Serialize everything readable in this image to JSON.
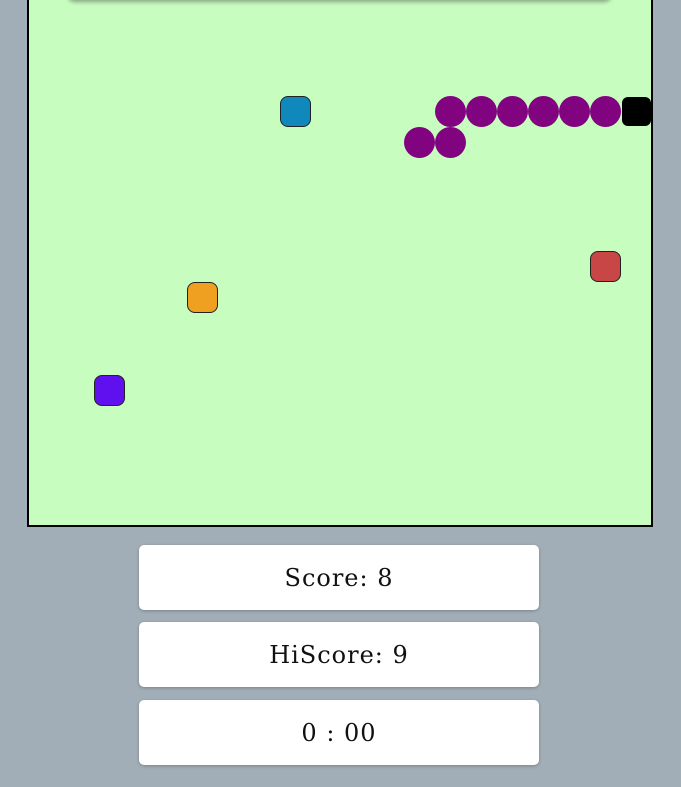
{
  "colors": {
    "page_background": "#a2aeb7",
    "board_background": "#c8fdc0",
    "snake_body": "#820380",
    "snake_head": "#000000"
  },
  "snake": {
    "head_cell": [
      19,
      3
    ],
    "body_cells": [
      [
        18,
        3
      ],
      [
        17,
        3
      ],
      [
        16,
        3
      ],
      [
        15,
        3
      ],
      [
        14,
        3
      ],
      [
        13,
        3
      ],
      [
        13,
        4
      ],
      [
        12,
        4
      ]
    ]
  },
  "items": [
    {
      "name": "blue-block",
      "color": "#1188bb",
      "cell": [
        8,
        3
      ]
    },
    {
      "name": "red-block",
      "color": "#c84646",
      "cell": [
        18,
        8
      ]
    },
    {
      "name": "orange-block",
      "color": "#f0a020",
      "cell": [
        5,
        9
      ]
    },
    {
      "name": "purple-block",
      "color": "#6010ee",
      "cell": [
        2,
        12
      ]
    }
  ],
  "score": {
    "text": "Score: 8"
  },
  "hiscore": {
    "text": "HiScore: 9"
  },
  "timer": {
    "text": "0 : 00"
  }
}
